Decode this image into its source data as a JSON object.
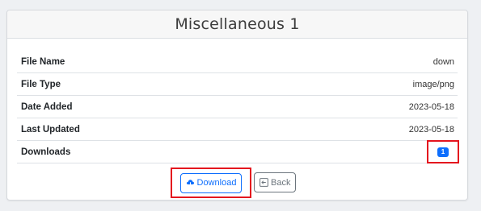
{
  "card": {
    "title": "Miscellaneous 1"
  },
  "details": [
    {
      "label": "File Name",
      "value": "down"
    },
    {
      "label": "File Type",
      "value": "image/png"
    },
    {
      "label": "Date Added",
      "value": "2023-05-18"
    },
    {
      "label": "Last Updated",
      "value": "2023-05-18"
    },
    {
      "label": "Downloads",
      "value": "1"
    }
  ],
  "actions": {
    "download_label": "Download",
    "download_icon": "cloud-download-icon",
    "back_label": "Back",
    "back_icon": "back-arrow-icon"
  },
  "colors": {
    "primary": "#0d6efd",
    "secondary": "#6c757d",
    "highlight": "#e4141e"
  }
}
